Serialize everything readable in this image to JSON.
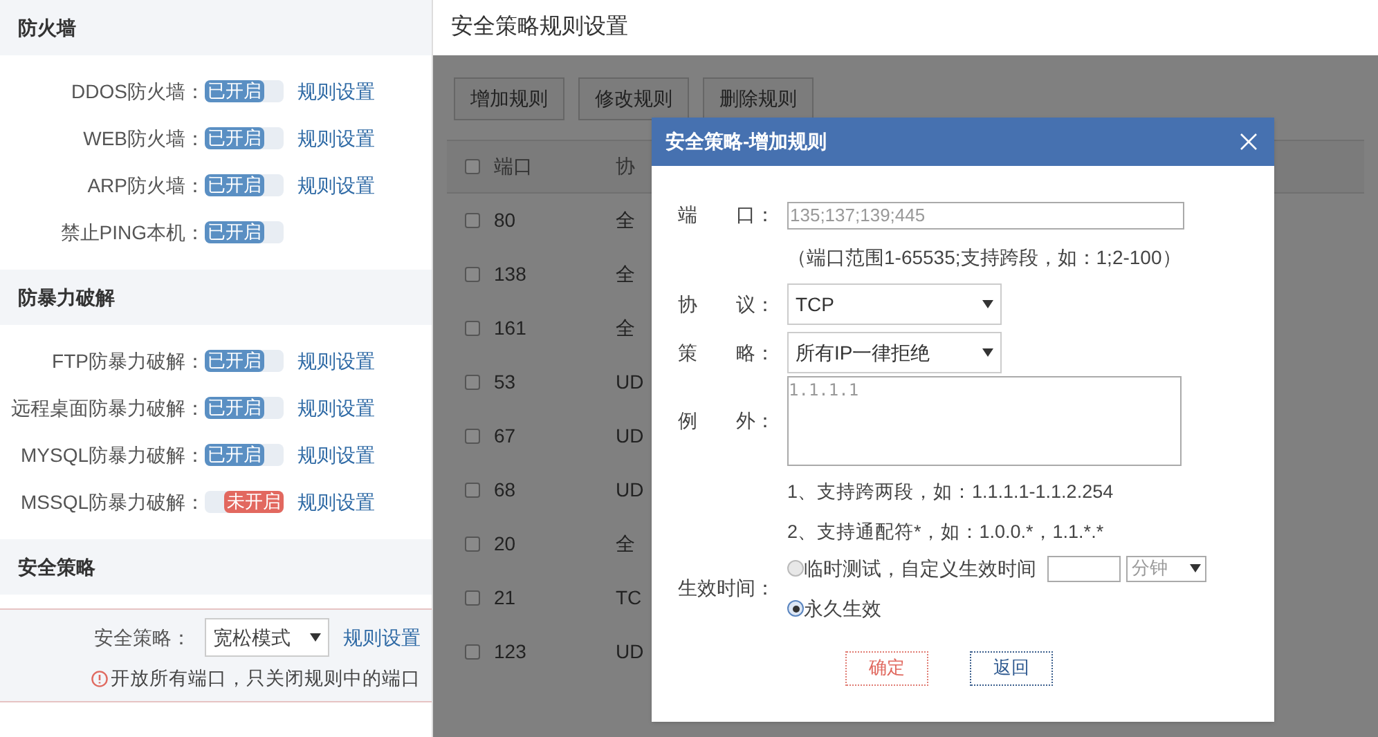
{
  "left_panel": {
    "sections": [
      {
        "title": "防火墙",
        "items": [
          {
            "label": "DDOS防火墙：",
            "on": true,
            "status": "已开启",
            "link": "规则设置"
          },
          {
            "label": "WEB防火墙：",
            "on": true,
            "status": "已开启",
            "link": "规则设置"
          },
          {
            "label": "ARP防火墙：",
            "on": true,
            "status": "已开启",
            "link": "规则设置"
          },
          {
            "label": "禁止PING本机：",
            "on": true,
            "status": "已开启"
          }
        ]
      },
      {
        "title": "防暴力破解",
        "items": [
          {
            "label": "FTP防暴力破解：",
            "on": true,
            "status": "已开启",
            "link": "规则设置"
          },
          {
            "label": "远程桌面防暴力破解：",
            "on": true,
            "status": "已开启",
            "link": "规则设置"
          },
          {
            "label": "MYSQL防暴力破解：",
            "on": true,
            "status": "已开启",
            "link": "规则设置"
          },
          {
            "label": "MSSQL防暴力破解：",
            "on": false,
            "status": "未开启",
            "link": "规则设置"
          }
        ]
      },
      {
        "title": "安全策略"
      }
    ],
    "policy": {
      "label": "安全策略：",
      "value": "宽松模式",
      "link": "规则设置",
      "notice": "开放所有端口，只关闭规则中的端口"
    }
  },
  "page_title": "安全策略规则设置",
  "toolbar": [
    "增加规则",
    "修改规则",
    "删除规则"
  ],
  "table": {
    "all_checked": false,
    "columns": [
      "端口",
      "协"
    ],
    "rows": [
      {
        "checked": false,
        "cells": [
          "80",
          "全"
        ]
      },
      {
        "checked": false,
        "cells": [
          "138",
          "全"
        ]
      },
      {
        "checked": false,
        "cells": [
          "161",
          "全"
        ]
      },
      {
        "checked": false,
        "cells": [
          "53",
          "UD"
        ]
      },
      {
        "checked": false,
        "cells": [
          "67",
          "UD"
        ]
      },
      {
        "checked": false,
        "cells": [
          "68",
          "UD"
        ]
      },
      {
        "checked": false,
        "cells": [
          "20",
          "全"
        ]
      },
      {
        "checked": false,
        "cells": [
          "21",
          "TC"
        ]
      },
      {
        "checked": false,
        "cells": [
          "123",
          "UD"
        ]
      }
    ]
  },
  "dialog": {
    "title": "安全策略-增加规则",
    "port": {
      "label": "端　　口：",
      "placeholder": "135;137;139;445",
      "hint": "（端口范围1-65535;支持跨段，如：1;2-100）"
    },
    "protocol": {
      "label": "协　　议：",
      "value": "TCP"
    },
    "strategy": {
      "label": "策　　略：",
      "value": "所有IP一律拒绝"
    },
    "exception": {
      "label": "例　　外：",
      "placeholder": "1.1.1.1",
      "notes": [
        "1、支持跨两段，如：1.1.1.1-1.1.2.254",
        "2、支持通配符*，如：1.0.0.*，1.1.*.*"
      ]
    },
    "effective": {
      "label": "生效时间：",
      "options": [
        {
          "label": "临时测试，自定义生效时间",
          "selected": false,
          "kind": "custom",
          "unit": "分钟"
        },
        {
          "label": "永久生效",
          "selected": true,
          "kind": "plain"
        }
      ]
    },
    "buttons": [
      {
        "label": "确定",
        "kind": "confirm"
      },
      {
        "label": "返回",
        "kind": "cancel"
      }
    ]
  }
}
